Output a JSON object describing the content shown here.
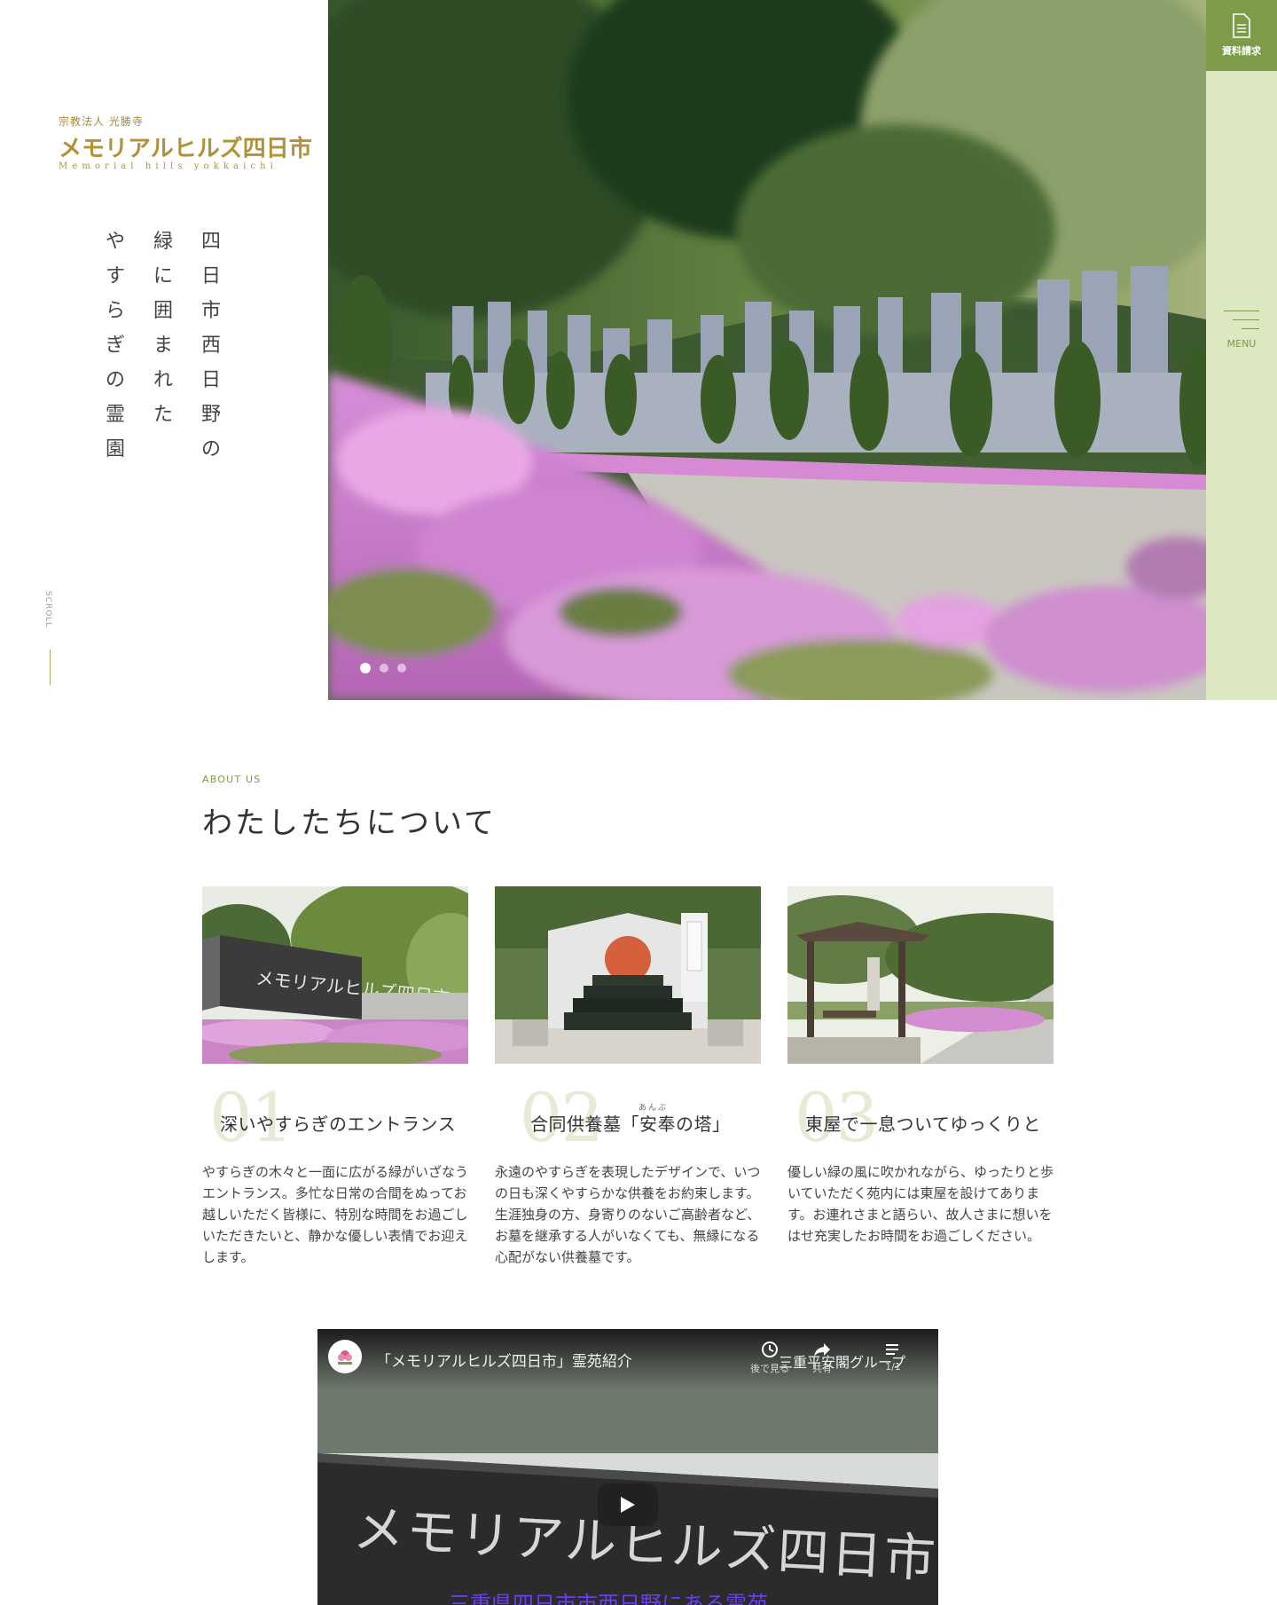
{
  "brand": {
    "org": "宗教法人 光勝寺",
    "name": "メモリアルヒルズ四日市",
    "romaji": "Memorial hills yokkaichi"
  },
  "hero": {
    "tagline_columns": [
      [
        "四",
        "日",
        "市",
        "西",
        "日",
        "野",
        "の"
      ],
      [
        "緑",
        "に",
        "囲",
        "ま",
        "れ",
        "た"
      ],
      [
        "や",
        "す",
        "ら",
        "ぎ",
        "の",
        "霊",
        "園"
      ]
    ],
    "scroll_label": "SCROLL",
    "slides": 3,
    "active_slide": 1
  },
  "rightbar": {
    "request_label": "資料請求",
    "menu_label": "MENU"
  },
  "about": {
    "en_label": "ABOUT US",
    "title": "わたしたちについて",
    "cards": [
      {
        "num": "01",
        "title": "深いやすらぎのエントランス",
        "ruby": "",
        "text": "やすらぎの木々と一面に広がる緑がいざなうエントランス。多忙な日常の合間をぬってお越しいただく皆様に、特別な時間をお過ごしいただきたいと、静かな優しい表情でお迎えします。"
      },
      {
        "num": "02",
        "title": "合同供養墓「安奉の塔」",
        "ruby": "あんぶ",
        "text": "永遠のやすらぎを表現したデザインで、いつの日も深くやすらかな供養をお約束します。生涯独身の方、身寄りのないご高齢者など、お墓を継承する人がいなくても、無縁になる心配がない供養墓です。"
      },
      {
        "num": "03",
        "title": "東屋で一息ついてゆっくりと",
        "ruby": "",
        "text": "優しい緑の風に吹かれながら、ゆったりと歩いていただく苑内には東屋を設けてあります。お連れさまと語らい、故人さまに想いをはせ充実したお時間をお過ごしください。"
      }
    ]
  },
  "video": {
    "title": "「メモリアルヒルズ四日市」霊苑紹介",
    "watch_later": "後で見る",
    "share": "共有",
    "playlist": "1/1",
    "channel": "三重平安閣グループ",
    "sign_text": "メモリアルヒルズ四日市",
    "caption": "三重県四日市市西日野にある霊苑"
  },
  "colors": {
    "accent_green": "#7d9b48",
    "light_green": "#dbe8c2",
    "brand_gold": "#b19238"
  }
}
